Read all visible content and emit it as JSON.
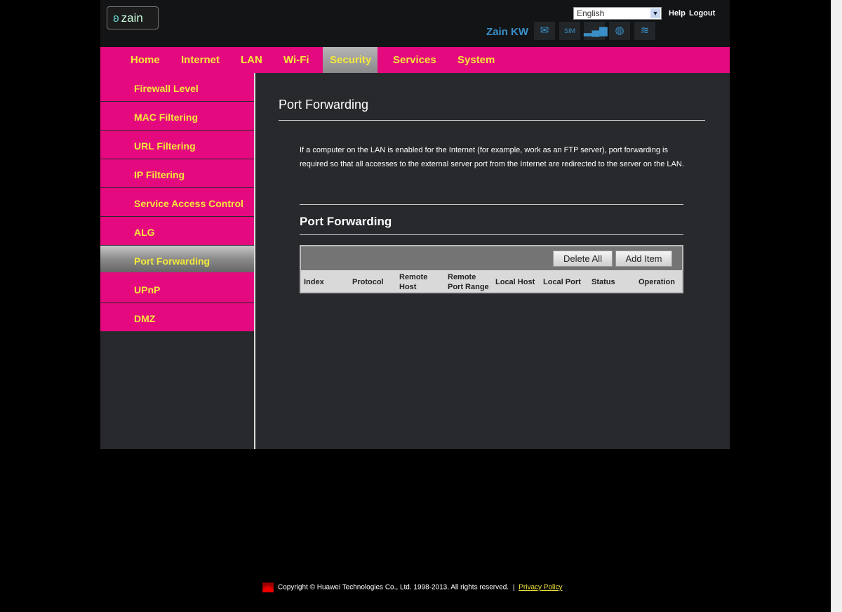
{
  "header": {
    "logo": "zain",
    "language": "English",
    "help": "Help",
    "logout": "Logout",
    "operator": "Zain KW",
    "icons": [
      "mail-icon",
      "sim-icon",
      "signal-icon",
      "globe-icon",
      "wifi-icon"
    ]
  },
  "nav": {
    "items": [
      "Home",
      "Internet",
      "LAN",
      "Wi-Fi",
      "Security",
      "Services",
      "System"
    ],
    "active": "Security"
  },
  "sidebar": {
    "items": [
      "Firewall Level",
      "MAC Filtering",
      "URL Filtering",
      "IP Filtering",
      "Service Access Control",
      "ALG",
      "Port Forwarding",
      "UPnP",
      "DMZ"
    ],
    "active": "Port Forwarding"
  },
  "main": {
    "title": "Port Forwarding",
    "description": "If a computer on the LAN is enabled for the Internet (for example, work as an FTP server), port forwarding is required so that all accesses to the external server port from the Internet are redirected to the server on the LAN.",
    "section_title": "Port Forwarding",
    "delete_all": "Delete All",
    "add_item": "Add Item",
    "columns": [
      "Index",
      "Protocol",
      "Remote Host",
      "Remote Port Range",
      "Local Host",
      "Local Port",
      "Status",
      "Operation"
    ]
  },
  "footer": {
    "copyright": "Copyright © Huawei Technologies Co., Ltd. 1998-2013. All rights reserved.",
    "sep": "|",
    "privacy": "Privacy Policy"
  },
  "colors": {
    "accent": "#e5097f",
    "nav_text": "#f5e83a",
    "operator": "#3a8fc8"
  }
}
